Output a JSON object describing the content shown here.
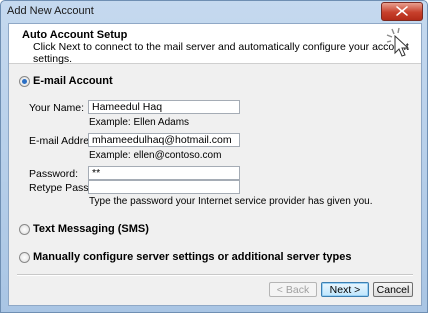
{
  "window": {
    "title": "Add New Account"
  },
  "header": {
    "title": "Auto Account Setup",
    "description": "Click Next to connect to the mail server and automatically configure your account settings."
  },
  "options": {
    "email_account_label": "E-mail Account",
    "text_messaging_label": "Text Messaging (SMS)",
    "manual_config_label": "Manually configure server settings or additional server types",
    "selected": "E-mail Account"
  },
  "form": {
    "name_label": "Your Name:",
    "name_value": "Hameedul Haq",
    "name_example": "Example: Ellen Adams",
    "email_label": "E-mail Address:",
    "email_value": "mhameedulhaq@hotmail.com",
    "email_example": "Example: ellen@contoso.com",
    "password_label": "Password:",
    "password_value": "**",
    "retype_label": "Retype Password:",
    "retype_value": "",
    "password_hint": "Type the password your Internet service provider has given you."
  },
  "buttons": {
    "back": "< Back",
    "next": "Next >",
    "cancel": "Cancel"
  }
}
